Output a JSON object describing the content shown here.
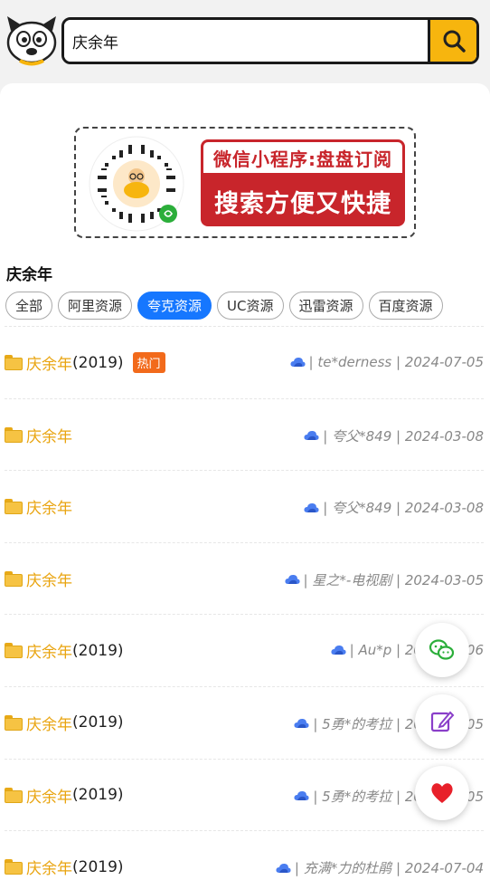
{
  "search": {
    "value": "庆余年",
    "button_icon": "search-icon"
  },
  "banner": {
    "line1": "微信小程序:盘盘订阅",
    "line2": "搜索方便又快捷"
  },
  "section_title": "庆余年",
  "tabs": [
    {
      "label": "全部",
      "active": false
    },
    {
      "label": "阿里资源",
      "active": false
    },
    {
      "label": "夸克资源",
      "active": true
    },
    {
      "label": "UC资源",
      "active": false
    },
    {
      "label": "迅雷资源",
      "active": false
    },
    {
      "label": "百度资源",
      "active": false
    }
  ],
  "results": [
    {
      "keyword": "庆余年",
      "suffix": "(2019)",
      "hot": "热门",
      "meta": "| te*derness | 2024-07-05"
    },
    {
      "keyword": "庆余年",
      "suffix": "",
      "hot": "",
      "meta": "| 夸父*849 | 2024-03-08"
    },
    {
      "keyword": "庆余年",
      "suffix": "",
      "hot": "",
      "meta": "| 夸父*849 | 2024-03-08"
    },
    {
      "keyword": "庆余年",
      "suffix": "",
      "hot": "",
      "meta": "| 星之*-电视剧 | 2024-03-05"
    },
    {
      "keyword": "庆余年",
      "suffix": "(2019)",
      "hot": "",
      "meta": "| Au*p | 2024-07-06"
    },
    {
      "keyword": "庆余年",
      "suffix": "(2019)",
      "hot": "",
      "meta": "| 5勇*的考拉 | 2024-07-05"
    },
    {
      "keyword": "庆余年",
      "suffix": "(2019)",
      "hot": "",
      "meta": "| 5勇*的考拉 | 2024-07-05"
    },
    {
      "keyword": "庆余年",
      "suffix": "(2019)",
      "hot": "",
      "meta": "| 充满*力的杜鹃 | 2024-07-04"
    }
  ],
  "fabs": [
    {
      "icon": "wechat-icon",
      "color": "#2bae3a"
    },
    {
      "icon": "edit-icon",
      "color": "#8a3fc9"
    },
    {
      "icon": "heart-icon",
      "color": "#e8202a"
    }
  ]
}
